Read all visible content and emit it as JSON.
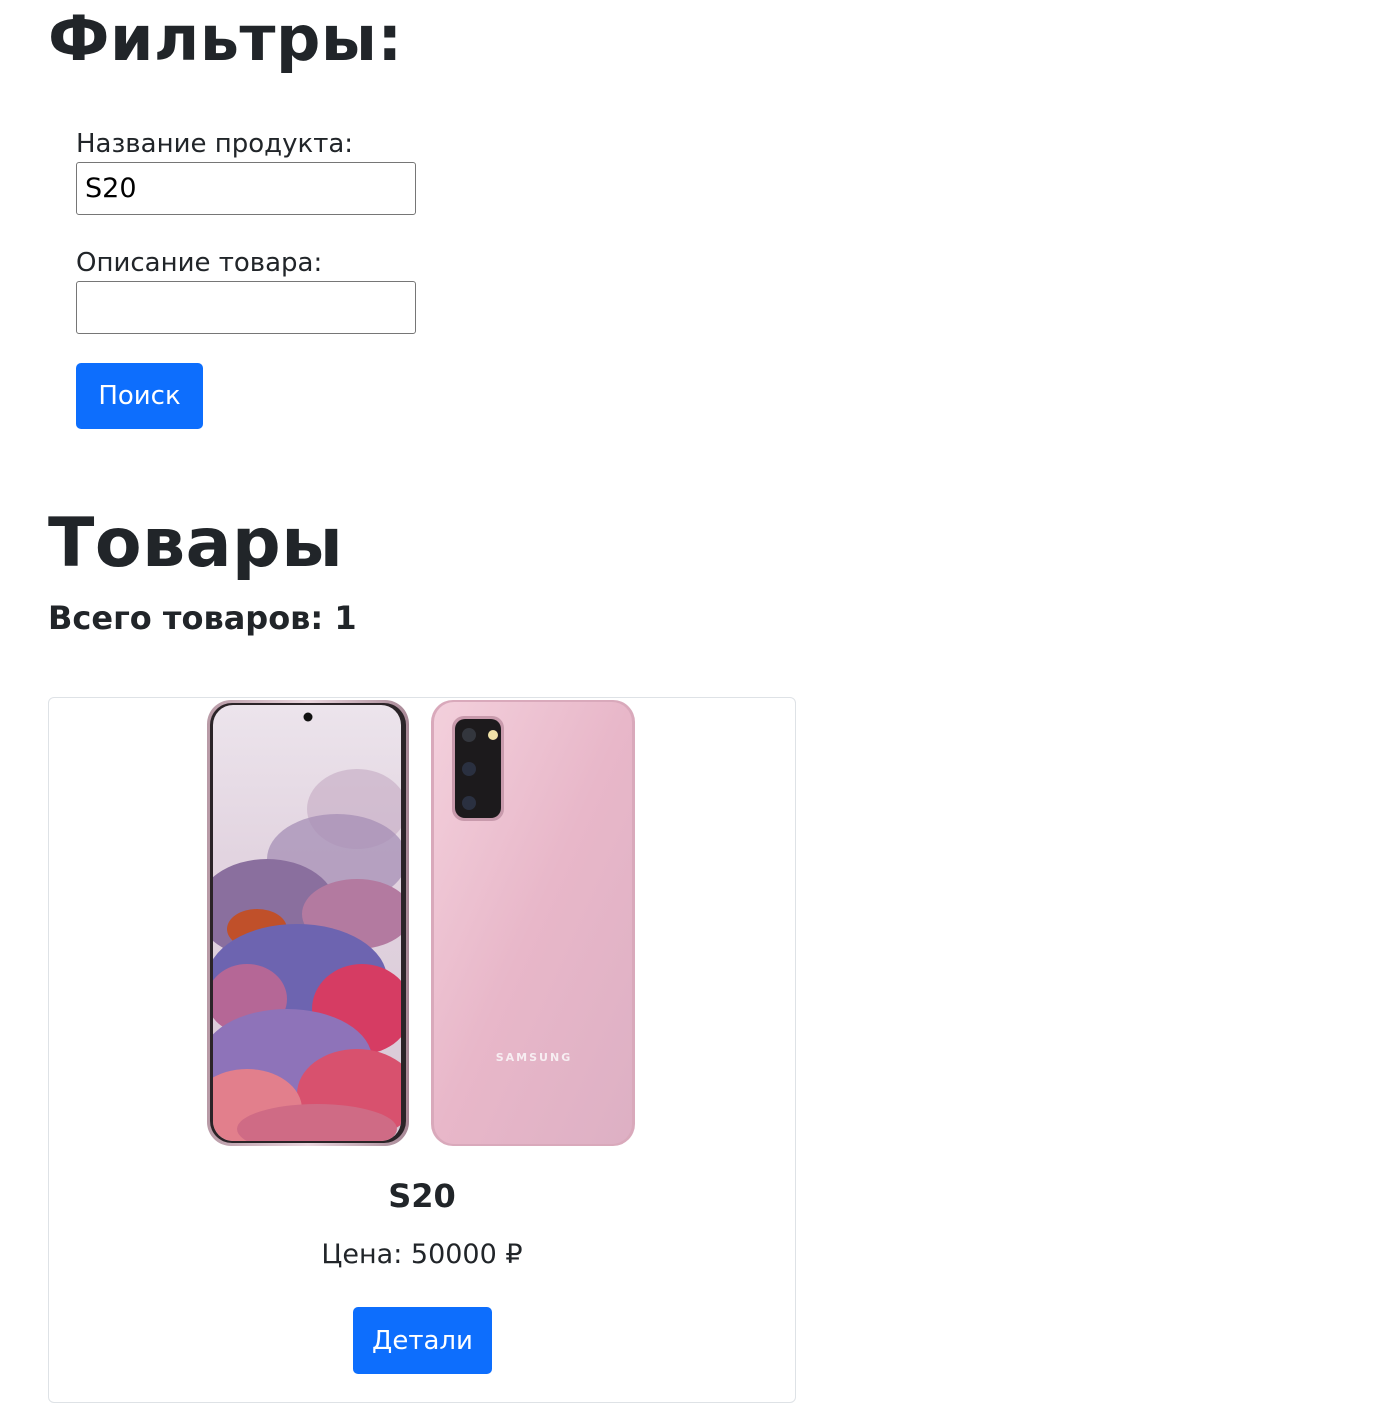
{
  "filters": {
    "title": "Фильтры:",
    "name_label": "Название продукта:",
    "name_value": "S20",
    "description_label": "Описание товара:",
    "description_value": "",
    "search_button": "Поиск"
  },
  "products": {
    "title": "Товары",
    "total_label": "Всего товаров:",
    "total_count": "1",
    "items": [
      {
        "name": "S20",
        "price_label": "Цена:",
        "price": "50000",
        "currency": "₽",
        "details_button": "Детали",
        "image_brand_text": "SAMSUNG"
      }
    ]
  },
  "colors": {
    "primary": "#0d6efd",
    "text": "#212529",
    "card_border": "#dee2e6",
    "phone_pink": "#e9b9ca"
  }
}
